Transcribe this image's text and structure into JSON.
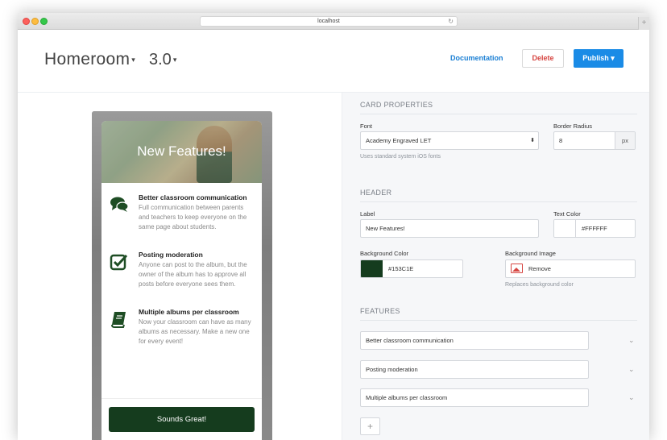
{
  "browser": {
    "url": "localhost",
    "reload_icon": "↻",
    "new_tab_icon": "+"
  },
  "header": {
    "app_name": "Homeroom",
    "app_caret": "▾",
    "version": "3.0",
    "version_caret": "▾",
    "documentation": "Documentation",
    "delete": "Delete",
    "publish": "Publish ▾"
  },
  "preview": {
    "card_title": "New Features!",
    "features": [
      {
        "icon": "speech-bubbles-icon",
        "glyph": "💬",
        "title": "Better classroom communication",
        "desc": "Full communication between parents and teachers to keep everyone on the same page about students."
      },
      {
        "icon": "checkbox-icon",
        "glyph": "☑",
        "title": "Posting moderation",
        "desc": "Anyone can post to the album, but the owner of the album has to approve all posts before everyone sees them."
      },
      {
        "icon": "book-icon",
        "glyph": "📗",
        "title": "Multiple albums per classroom",
        "desc": "Now your classroom can have as many albums as necessary. Make a new one for every event!"
      }
    ],
    "button": "Sounds Great!"
  },
  "panel": {
    "card_properties": {
      "heading": "CARD PROPERTIES",
      "font_label": "Font",
      "font_value": "Academy Engraved LET",
      "font_help": "Uses standard system iOS fonts",
      "radius_label": "Border Radius",
      "radius_value": "8",
      "radius_unit": "px"
    },
    "header": {
      "heading": "HEADER",
      "label_label": "Label",
      "label_value": "New Features!",
      "text_color_label": "Text Color",
      "text_color_value": "#FFFFFF",
      "bg_color_label": "Background Color",
      "bg_color_value": "#153C1E",
      "bg_image_label": "Background Image",
      "bg_image_remove": "Remove",
      "bg_image_help": "Replaces background color"
    },
    "features": {
      "heading": "FEATURES",
      "items": [
        "Better classroom communication",
        "Posting moderation",
        "Multiple albums per classroom"
      ],
      "chevron": "⌄",
      "add": "+"
    }
  },
  "colors": {
    "accent": "#1a8be6",
    "danger": "#d64541",
    "card_button": "#153c1e",
    "text_color_swatch": "#FFFFFF",
    "bg_color_swatch": "#153C1E"
  }
}
